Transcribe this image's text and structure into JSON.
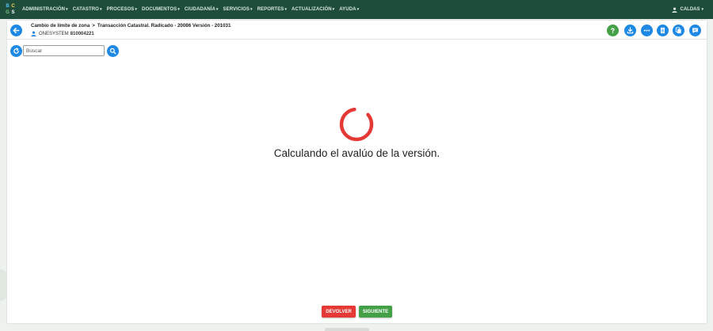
{
  "nav": {
    "logo_letters": [
      "B",
      "C",
      "G",
      "S"
    ],
    "items": [
      {
        "label": "ADMINISTRACIÓN"
      },
      {
        "label": "CATASTRO"
      },
      {
        "label": "PROCESOS"
      },
      {
        "label": "DOCUMENTOS"
      },
      {
        "label": "CIUDADANÍA"
      },
      {
        "label": "SERVICIOS"
      },
      {
        "label": "REPORTES"
      },
      {
        "label": "ACTUALIZACIÓN"
      },
      {
        "label": "AYUDA"
      }
    ],
    "caret": "▾",
    "user": "CALDAS"
  },
  "header": {
    "breadcrumb_parent": "Cambio de límite de zona",
    "breadcrumb_separator": ">",
    "breadcrumb_current": "Transacción Catastral. Radicado - 20086 Versión - 201031",
    "owner_name": "ONESYSTEM",
    "owner_code": "810004221"
  },
  "toolbar": {
    "icons": [
      "help-icon",
      "download-icon",
      "more-icon",
      "document-icon",
      "copy-icon",
      "comment-icon"
    ]
  },
  "search": {
    "placeholder": "Buscar"
  },
  "loading": {
    "message": "Calculando el avalúo de la versión."
  },
  "actions": {
    "return_label": "DEVOLVER",
    "next_label": "SIGUIENTE"
  },
  "colors": {
    "nav_bg": "#1e4d3c",
    "primary": "#1e88e5",
    "success": "#43a047",
    "danger": "#e53935",
    "spinner": "#e53935"
  }
}
